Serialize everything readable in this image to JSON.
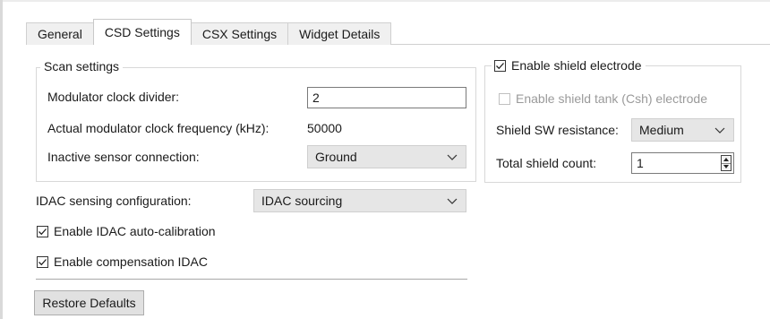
{
  "tabs": [
    {
      "label": "General"
    },
    {
      "label": "CSD Settings"
    },
    {
      "label": "CSX Settings"
    },
    {
      "label": "Widget Details"
    }
  ],
  "active_tab": "CSD Settings",
  "scan_settings": {
    "legend": "Scan settings",
    "mod_clk_div_label": "Modulator clock divider:",
    "mod_clk_div_value": "2",
    "actual_freq_label": "Actual modulator clock frequency (kHz):",
    "actual_freq_value": "50000",
    "inactive_label": "Inactive sensor connection:",
    "inactive_value": "Ground"
  },
  "idac": {
    "config_label": "IDAC sensing configuration:",
    "config_value": "IDAC sourcing",
    "auto_cal_label": "Enable IDAC auto-calibration",
    "auto_cal_checked": true,
    "comp_label": "Enable compensation IDAC",
    "comp_checked": true
  },
  "shield": {
    "enable_label": "Enable shield electrode",
    "enable_checked": true,
    "tank_label": "Enable shield tank (Csh) electrode",
    "tank_checked": false,
    "sw_res_label": "Shield SW resistance:",
    "sw_res_value": "Medium",
    "count_label": "Total shield count:",
    "count_value": "1"
  },
  "restore_label": "Restore Defaults"
}
